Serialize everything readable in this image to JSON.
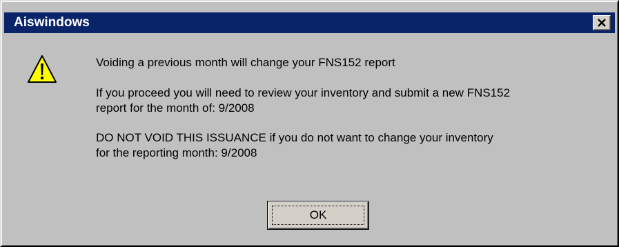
{
  "window": {
    "title": "Aiswindows",
    "close_icon": "close-icon"
  },
  "dialog": {
    "icon": "warning-icon",
    "line1": "Voiding a previous month will change your FNS152 report",
    "line2a": "If you proceed you will need to review your inventory and submit a new FNS152",
    "line2b": "report for the month of: 9/2008",
    "line3a": "DO NOT VOID THIS ISSUANCE if you do not want to change your inventory",
    "line3b": "for the reporting month: 9/2008"
  },
  "buttons": {
    "ok_label": "OK"
  },
  "colors": {
    "titlebar": "#0a246a",
    "face": "#c0c0c0",
    "warning_yellow": "#ffff00"
  }
}
